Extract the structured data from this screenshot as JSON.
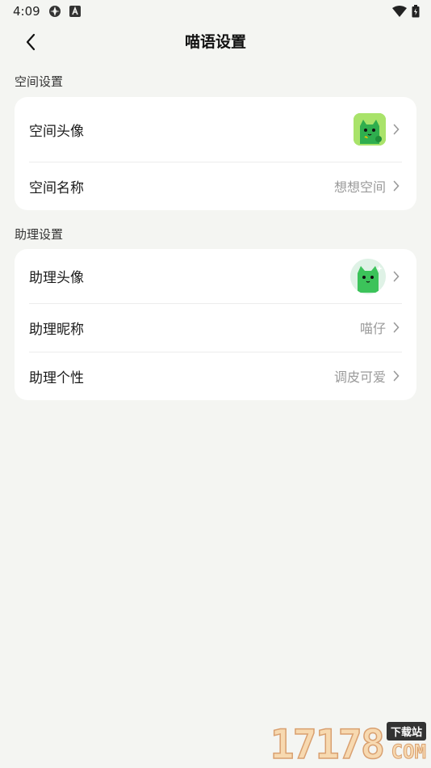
{
  "status_bar": {
    "time": "4:09"
  },
  "header": {
    "title": "喵语设置"
  },
  "space_section": {
    "label": "空间设置",
    "avatar_label": "空间头像",
    "name_label": "空间名称",
    "name_value": "想想空间"
  },
  "assistant_section": {
    "label": "助理设置",
    "avatar_label": "助理头像",
    "nickname_label": "助理昵称",
    "nickname_value": "喵仔",
    "personality_label": "助理个性",
    "personality_value": "调皮可爱"
  },
  "watermark": {
    "number": "17178",
    "tag": "下载站",
    "domain": "COM"
  },
  "colors": {
    "background": "#f4f5f2",
    "card": "#ffffff",
    "avatar_green": "#3cc35a"
  }
}
